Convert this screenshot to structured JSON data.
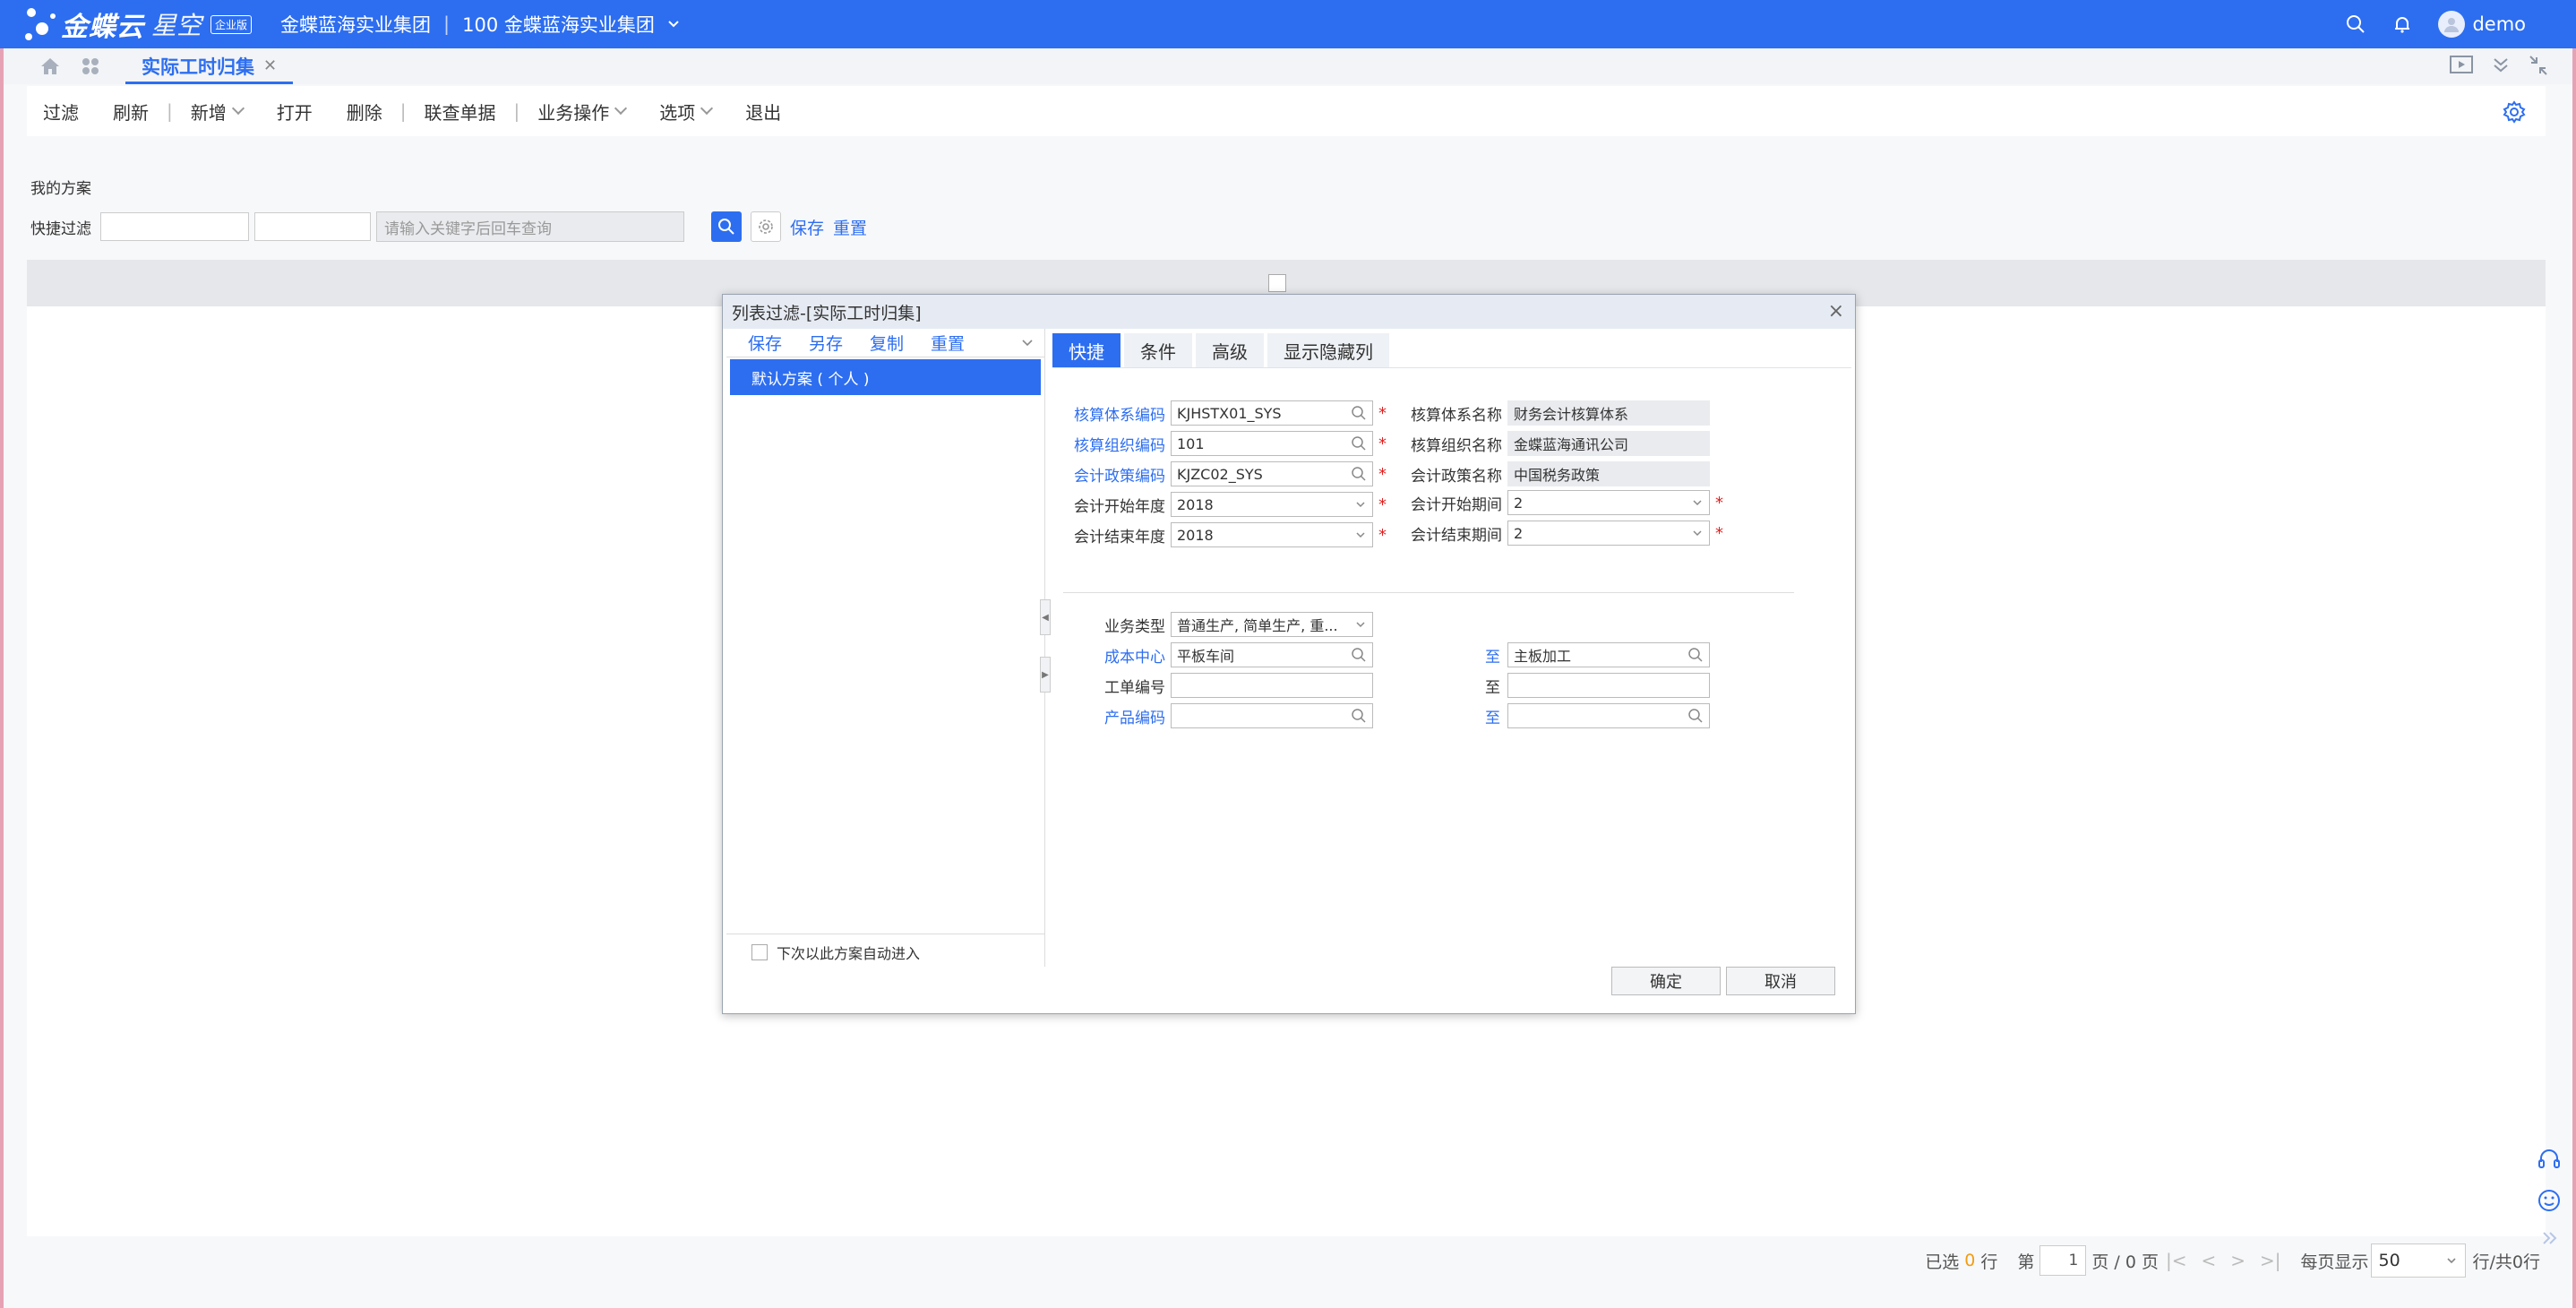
{
  "app": {
    "logo_text": "金蝶云",
    "logo_sub": "星空",
    "logo_badge": "企业版",
    "org_name": "金蝶蓝海实业集团",
    "org_code_name": "100 金蝶蓝海实业集团",
    "username": "demo",
    "accent_color": "#2d6ef0"
  },
  "tabs": {
    "active_label": "实际工时归集"
  },
  "toolbar": {
    "filter": "过滤",
    "refresh": "刷新",
    "new": "新增",
    "open": "打开",
    "delete": "删除",
    "linked_query": "联查单据",
    "business_ops": "业务操作",
    "options": "选项",
    "exit": "退出"
  },
  "filter_area": {
    "my_scheme": "我的方案",
    "quick_filter": "快捷过滤",
    "search_placeholder": "请输入关键字后回车查询",
    "save": "保存",
    "reset": "重置"
  },
  "pager": {
    "selected_prefix": "已选",
    "selected_count": "0",
    "selected_suffix": "行",
    "page_prefix": "第",
    "page_number": "1",
    "page_mid": "页 / 0 页",
    "per_page_label": "每页显示",
    "per_page_value": "50",
    "total_text": "行/共0行"
  },
  "dialog": {
    "title": "列表过滤-[实际工时归集]",
    "scheme_tools": {
      "save": "保存",
      "save_as": "另存",
      "copy": "复制",
      "reset": "重置"
    },
    "selected_scheme": "默认方案 ( 个人 )",
    "auto_enter": "下次以此方案自动进入",
    "tabs": [
      "快捷",
      "条件",
      "高级",
      "显示隐藏列"
    ],
    "fields": {
      "acct_system_code_label": "核算体系编码",
      "acct_system_code": "KJHSTX01_SYS",
      "acct_system_name_label": "核算体系名称",
      "acct_system_name": "财务会计核算体系",
      "acct_org_code_label": "核算组织编码",
      "acct_org_code": "101",
      "acct_org_name_label": "核算组织名称",
      "acct_org_name": "金蝶蓝海通讯公司",
      "policy_code_label": "会计政策编码",
      "policy_code": "KJZC02_SYS",
      "policy_name_label": "会计政策名称",
      "policy_name": "中国税务政策",
      "start_year_label": "会计开始年度",
      "start_year": "2018",
      "start_period_label": "会计开始期间",
      "start_period": "2",
      "end_year_label": "会计结束年度",
      "end_year": "2018",
      "end_period_label": "会计结束期间",
      "end_period": "2",
      "biz_type_label": "业务类型",
      "biz_type": "普通生产, 简单生产, 重...",
      "cost_center_label": "成本中心",
      "cost_center_from": "平板车间",
      "to_label": "至",
      "cost_center_to": "主板加工",
      "work_order_label": "工单编号",
      "product_code_label": "产品编码"
    },
    "ok": "确定",
    "cancel": "取消"
  }
}
